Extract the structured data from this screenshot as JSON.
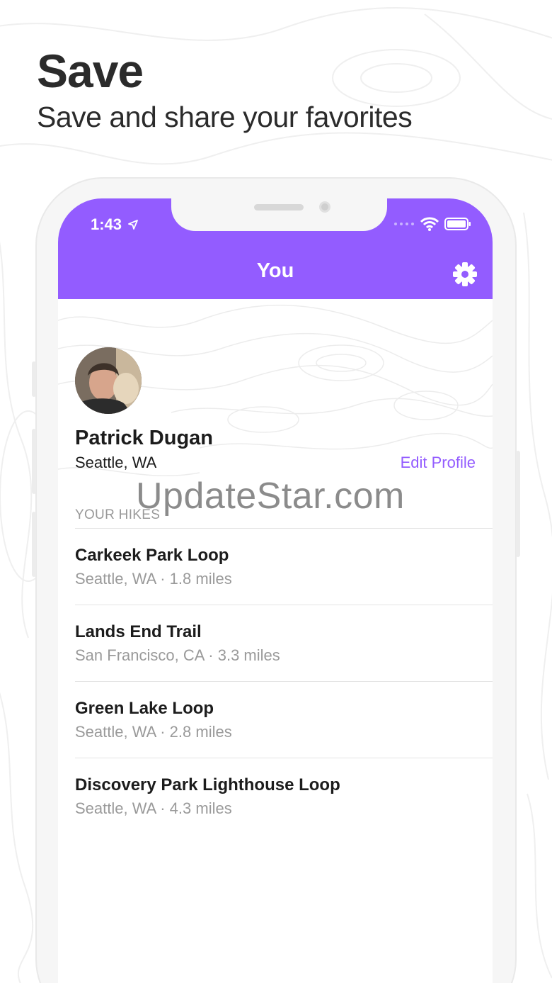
{
  "promo": {
    "title": "Save",
    "subtitle": "Save and share your favorites"
  },
  "status_bar": {
    "time": "1:43"
  },
  "navbar": {
    "title": "You",
    "settings_icon": "gear-icon",
    "background_color": "#935cff"
  },
  "profile": {
    "name": "Patrick Dugan",
    "location": "Seattle, WA",
    "edit_label": "Edit Profile"
  },
  "hikes_section": {
    "header": "YOUR HIKES",
    "items": [
      {
        "name": "Carkeek Park Loop",
        "meta": "Seattle, WA · 1.8 miles"
      },
      {
        "name": "Lands End Trail",
        "meta": "San Francisco, CA · 3.3 miles"
      },
      {
        "name": "Green Lake Loop",
        "meta": "Seattle, WA · 2.8 miles"
      },
      {
        "name": "Discovery Park Lighthouse Loop",
        "meta": "Seattle, WA · 4.3 miles"
      }
    ]
  },
  "watermark": "UpdateStar.com",
  "colors": {
    "accent": "#935cff",
    "text_primary": "#1c1c1c",
    "text_secondary": "#9a9a9a"
  }
}
